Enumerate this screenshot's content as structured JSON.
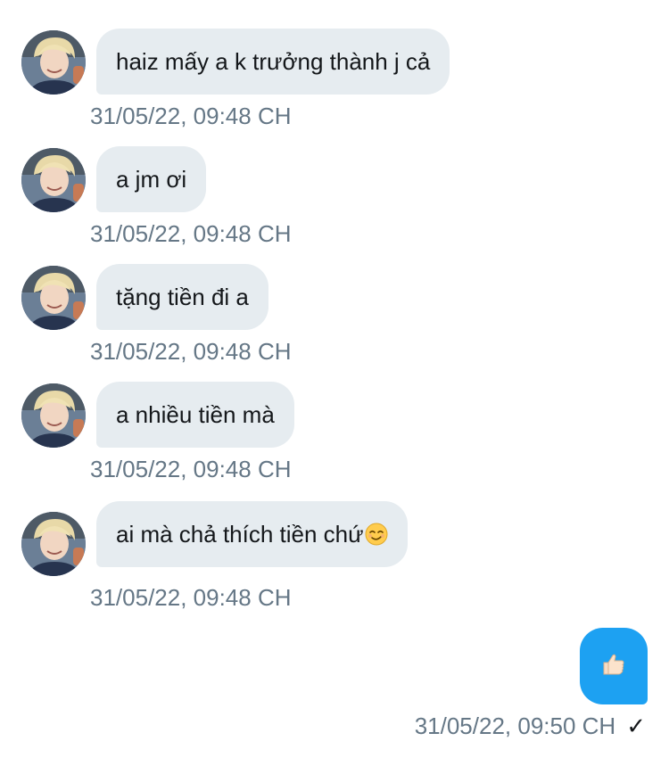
{
  "messages": [
    {
      "text": "haiz mấy a k trưởng thành j cả",
      "time": "31/05/22, 09:48 CH"
    },
    {
      "text": "a jm ơi",
      "time": "31/05/22, 09:48 CH"
    },
    {
      "text": "tặng tiền đi a",
      "time": "31/05/22, 09:48 CH"
    },
    {
      "text": "a nhiều tiền mà",
      "time": "31/05/22, 09:48 CH"
    },
    {
      "text": "ai mà chả thích tiền chứ",
      "emoji": "relieved-face-emoji",
      "time": "31/05/22, 09:48 CH"
    }
  ],
  "outgoing": {
    "content": "thumbs-up-emoji",
    "time": "31/05/22, 09:50 CH",
    "status": "✓"
  },
  "colors": {
    "incoming_bubble": "#e6ecf0",
    "outgoing_bubble": "#1da1f2",
    "timestamp": "#657786",
    "text": "#14171a"
  }
}
